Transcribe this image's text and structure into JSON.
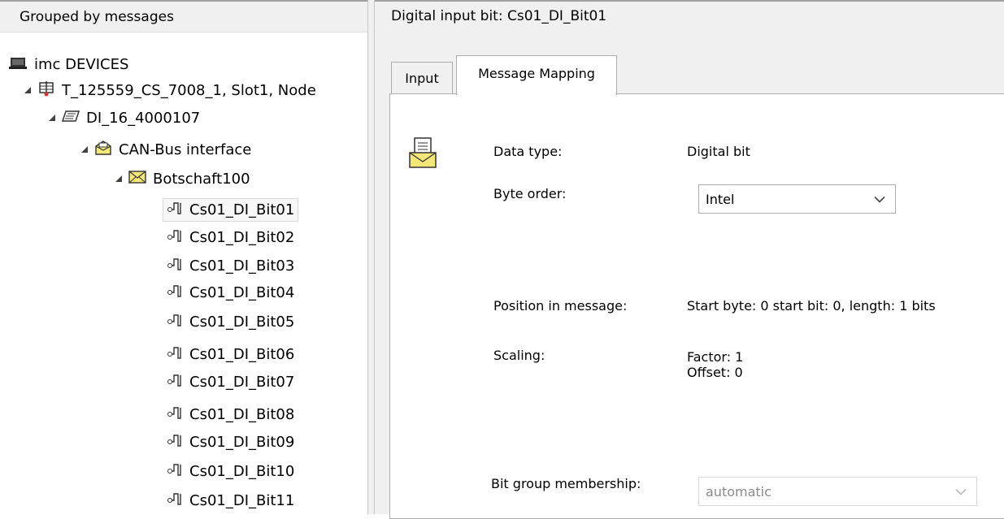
{
  "tree": {
    "header": "Grouped by messages",
    "root": "imc DEVICES",
    "device": "T_125559_CS_7008_1, Slot1, Node",
    "module": "DI_16_4000107",
    "interface": "CAN-Bus interface",
    "message": "Botschaft100",
    "bits": [
      "Cs01_DI_Bit01",
      "Cs01_DI_Bit02",
      "Cs01_DI_Bit03",
      "Cs01_DI_Bit04",
      "Cs01_DI_Bit05",
      "Cs01_DI_Bit06",
      "Cs01_DI_Bit07",
      "Cs01_DI_Bit08",
      "Cs01_DI_Bit09",
      "Cs01_DI_Bit10",
      "Cs01_DI_Bit11"
    ],
    "selected_bit": "Cs01_DI_Bit01"
  },
  "detail": {
    "title": "Digital input bit: Cs01_DI_Bit01",
    "tabs": [
      {
        "label": "Input",
        "active": false
      },
      {
        "label": "Message Mapping",
        "active": true
      }
    ],
    "data_type_label": "Data type:",
    "data_type_value": "Digital bit",
    "byte_order_label": "Byte order:",
    "byte_order_value": "Intel",
    "position_label": "Position in message:",
    "position_value": "Start byte: 0 start bit: 0, length: 1 bits",
    "scaling_label": "Scaling:",
    "scaling_factor": "Factor: 1",
    "scaling_offset": "Offset: 0",
    "bit_group_label": "Bit group membership:",
    "bit_group_value": "automatic"
  },
  "icons": {
    "devices": "devices-icon",
    "device": "device-icon",
    "module": "module-icon",
    "interface": "can-interface-icon",
    "message": "envelope-icon",
    "bit": "digital-bit-icon",
    "detail": "envelope-letter-icon"
  },
  "colors": {
    "envelope_fill": "#f3e77a",
    "panel_bg": "#f0f0f0",
    "selection_border": "#d9d9d9"
  }
}
